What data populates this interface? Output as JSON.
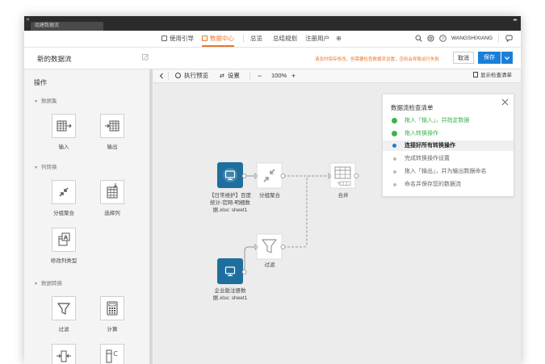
{
  "titlebar": {
    "tab_title": "组建数据流"
  },
  "topnav": {
    "items": [
      {
        "label": "使用引导",
        "active": false
      },
      {
        "label": "数据中心",
        "active": true
      },
      {
        "label": "总览",
        "active": false
      },
      {
        "label": "总结规划",
        "active": false
      },
      {
        "label": "注册用户",
        "active": false
      }
    ],
    "username": "WANGSHIXIANG"
  },
  "header": {
    "flow_name": "新的数据流",
    "warning": "请及时保存修改，但需要检查数据流设置，否则会导致运行失败",
    "cancel_label": "取消",
    "save_label": "保存"
  },
  "sidebar": {
    "title": "操作",
    "sections": [
      {
        "label": "数据集",
        "tools": [
          {
            "label": "输入",
            "icon": "input-table-icon"
          },
          {
            "label": "输出",
            "icon": "output-table-icon"
          }
        ]
      },
      {
        "label": "列转换",
        "tools": [
          {
            "label": "分组聚合",
            "icon": "group-aggregate-icon"
          },
          {
            "label": "选择列",
            "icon": "select-columns-icon"
          },
          {
            "label": "修改列类型",
            "icon": "column-type-icon"
          }
        ]
      },
      {
        "label": "数据转换",
        "tools": [
          {
            "label": "过滤",
            "icon": "filter-icon"
          },
          {
            "label": "计算",
            "icon": "calculator-icon"
          },
          {
            "label": "",
            "icon": "split-column-icon"
          },
          {
            "label": "",
            "icon": "column-c-icon"
          }
        ]
      }
    ]
  },
  "canvas_toolbar": {
    "run_preview": "执行预览",
    "settings": "设置",
    "zoom": "100%",
    "show_checklist": "显示检查清单"
  },
  "nodes": {
    "input1_label": "【日常维护】百度统计-官网-明细数据.xlsx: sheet1",
    "group_label": "分组聚合",
    "merge_label": "合并",
    "filter_label": "过滤",
    "input2_label": "企业版注册数据.xlsx: sheet1"
  },
  "checklist": {
    "title": "数据流检查清单",
    "items": [
      {
        "text": "拖入「输入」，并指定数据",
        "state": "done"
      },
      {
        "text": "拖入转换操作",
        "state": "done"
      },
      {
        "text": "连接好所有转换操作",
        "state": "current"
      },
      {
        "text": "完成转换操作设置",
        "state": "todo"
      },
      {
        "text": "拖入「输出」，并为输出数据命名",
        "state": "todo"
      },
      {
        "text": "命名并保存您的数据流",
        "state": "todo"
      }
    ]
  },
  "colors": {
    "accent": "#e8772e",
    "primary": "#1a7fd6",
    "success": "#3cb34a",
    "node_input": "#1f6f9e"
  }
}
